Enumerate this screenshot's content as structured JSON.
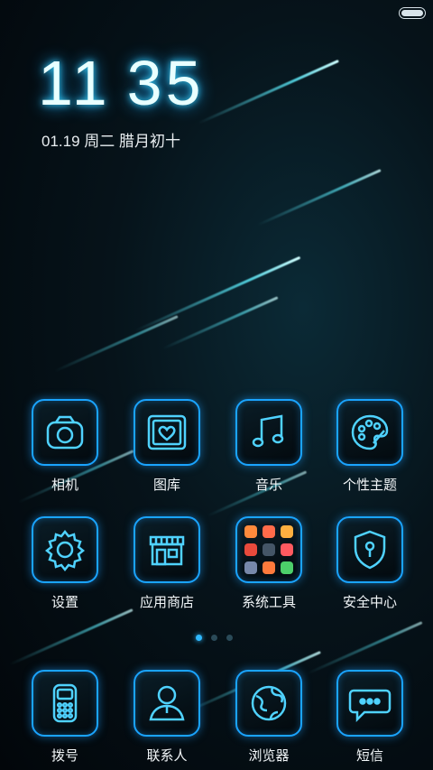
{
  "lockscreen": {
    "hour": "11",
    "minute": "35",
    "date": "01.19 周二 腊月初十"
  },
  "apps": [
    {
      "label": "相机",
      "icon": "camera-icon"
    },
    {
      "label": "图库",
      "icon": "gallery-icon"
    },
    {
      "label": "音乐",
      "icon": "music-note-icon"
    },
    {
      "label": "个性主题",
      "icon": "palette-icon"
    },
    {
      "label": "设置",
      "icon": "gear-icon"
    },
    {
      "label": "应用商店",
      "icon": "store-icon"
    },
    {
      "label": "系统工具",
      "icon": "folder-icon"
    },
    {
      "label": "安全中心",
      "icon": "shield-icon"
    }
  ],
  "dock": [
    {
      "label": "拨号",
      "icon": "phone-icon"
    },
    {
      "label": "联系人",
      "icon": "contact-icon"
    },
    {
      "label": "浏览器",
      "icon": "globe-icon"
    },
    {
      "label": "短信",
      "icon": "message-icon"
    }
  ],
  "pager": {
    "pages": 3,
    "active": 1
  },
  "colors": {
    "accent": "#1aa4ff",
    "glow": "#39d4ff",
    "background": "#03070b"
  }
}
